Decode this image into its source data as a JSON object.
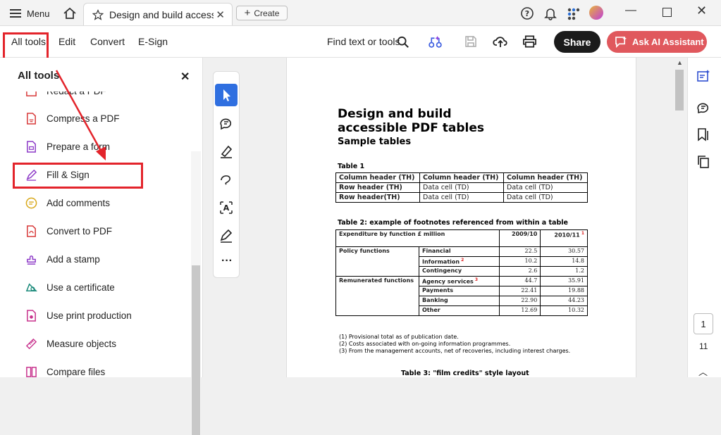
{
  "titlebar": {
    "menu_label": "Menu",
    "tab_title": "Design and build accessi...",
    "tab_close": "✕",
    "create_label": "Create"
  },
  "toolbar": {
    "items": [
      "All tools",
      "Edit",
      "Convert",
      "E-Sign"
    ],
    "find_label": "Find text or tools",
    "share_label": "Share",
    "ai_label": "Ask AI Assistant"
  },
  "leftpanel": {
    "title": "All tools",
    "tools": [
      "Redact a PDF",
      "Compress a PDF",
      "Prepare a form",
      "Fill & Sign",
      "Add comments",
      "Convert to PDF",
      "Add a stamp",
      "Use a certificate",
      "Use print production",
      "Measure objects",
      "Compare files"
    ]
  },
  "document": {
    "title_line1": "Design and build",
    "title_line2": "accessible PDF tables",
    "subtitle": "Sample tables",
    "table1": {
      "caption": "Table 1",
      "rows": [
        [
          "Column header (TH)",
          "Column header (TH)",
          "Column header (TH)"
        ],
        [
          "Row header (TH)",
          "Data cell (TD)",
          "Data cell (TD)"
        ],
        [
          "Row header(TH)",
          "Data cell (TD)",
          "Data cell (TD)"
        ]
      ]
    },
    "table2": {
      "caption": "Table 2: example of footnotes referenced from within a table",
      "header": [
        "Expenditure by function £ million",
        "2009/10",
        "2010/11"
      ],
      "groups": [
        {
          "name": "Policy functions",
          "rows": [
            [
              "Financial",
              "22.5",
              "30.57"
            ],
            [
              "Information",
              "10.2",
              "14.8"
            ],
            [
              "Contingency",
              "2.6",
              "1.2"
            ]
          ]
        },
        {
          "name": "Remunerated functions",
          "rows": [
            [
              "Agency services",
              "44.7",
              "35.91"
            ],
            [
              "Payments",
              "22.41",
              "19.88"
            ],
            [
              "Banking",
              "22.90",
              "44.23"
            ],
            [
              "Other",
              "12.69",
              "10.32"
            ]
          ]
        }
      ]
    },
    "footnotes": [
      "(1) Provisional total as of publication date.",
      "(2) Costs associated with on-going information programmes.",
      "(3) From the management accounts, net of recoveries, including interest charges."
    ],
    "table3_caption": "Table 3: \"film credits\" style layout"
  },
  "pager": {
    "current": "1",
    "total": "11"
  },
  "colors": {
    "accent_red": "#e3242b",
    "share_bg": "#1b1b1b",
    "ai_bg": "#e0585d",
    "tool_purple": "#7b2fb5"
  }
}
